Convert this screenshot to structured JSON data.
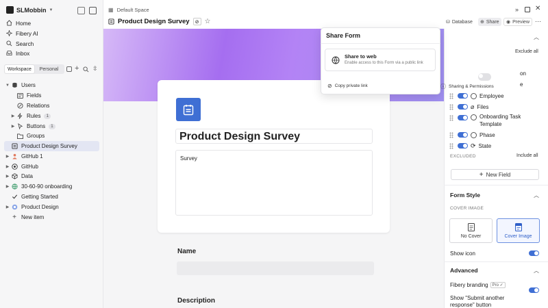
{
  "workspace": {
    "name": "SLMobbin"
  },
  "sidebar": {
    "nav": [
      {
        "label": "Home",
        "icon": "home-icon"
      },
      {
        "label": "Fibery AI",
        "icon": "sparkle-icon"
      },
      {
        "label": "Search",
        "icon": "search-icon"
      },
      {
        "label": "Inbox",
        "icon": "inbox-icon"
      }
    ],
    "tabs": [
      "Workspace",
      "Personal"
    ],
    "tree": [
      {
        "label": "Users",
        "icon": "database-icon",
        "expanded": true
      },
      {
        "label": "Fields",
        "icon": "fields-icon"
      },
      {
        "label": "Relations",
        "icon": "relations-icon"
      },
      {
        "label": "Rules",
        "icon": "lightning-icon",
        "count": "1"
      },
      {
        "label": "Buttons",
        "icon": "cursor-icon",
        "count": "1"
      },
      {
        "label": "Groups",
        "icon": "folder-icon"
      },
      {
        "label": "Product Design Survey",
        "icon": "form-icon",
        "selected": true
      },
      {
        "label": "GitHub 1",
        "icon": "person-icon"
      },
      {
        "label": "GitHub",
        "icon": "github-icon"
      },
      {
        "label": "Data",
        "icon": "cube-icon"
      },
      {
        "label": "30-60-90 onboarding",
        "icon": "globe-icon"
      },
      {
        "label": "Getting Started",
        "icon": "check-icon"
      },
      {
        "label": "Product Design",
        "icon": "target-icon"
      }
    ],
    "new_item": "New item"
  },
  "header": {
    "breadcrumb": "Default Space",
    "title": "Product Design Survey",
    "buttons": {
      "database": "Database",
      "share": "Share",
      "preview": "Preview"
    }
  },
  "form": {
    "title": "Product Design Survey",
    "description": "Survey",
    "fields": [
      {
        "label": "Name"
      },
      {
        "label": "Description"
      }
    ]
  },
  "share_popover": {
    "title": "Share Form",
    "share_web_title": "Share to web",
    "share_web_desc": "Enable access to this Form via a public link",
    "share_web_enabled": false,
    "copy_link": "Copy private link",
    "sharing_permissions": "Sharing & Permissions"
  },
  "right_panel": {
    "exclude_all": "Exclude all",
    "partial_row1": "on",
    "partial_row2": "e",
    "included_fields": [
      {
        "label": "Employee",
        "icon": "person-circle-icon",
        "on": true
      },
      {
        "label": "Files",
        "icon": "paperclip-icon",
        "on": true
      },
      {
        "label": "Onboarding Task Template",
        "icon": "relation-icon",
        "on": true
      },
      {
        "label": "Phase",
        "icon": "chevron-circle-icon",
        "on": true
      },
      {
        "label": "State",
        "icon": "workflow-icon",
        "on": true
      }
    ],
    "excluded_label": "EXCLUDED",
    "include_all": "Include all",
    "new_field": "New Field",
    "form_style": {
      "title": "Form Style",
      "cover_image_label": "COVER IMAGE",
      "options": [
        {
          "label": "No Cover",
          "selected": false
        },
        {
          "label": "Cover Image",
          "selected": true
        }
      ],
      "show_icon": "Show icon",
      "show_icon_on": true
    },
    "advanced": {
      "title": "Advanced",
      "fibery_branding": "Fibery branding",
      "pro_badge": "Pro",
      "fibery_branding_on": true,
      "submit_another_line1": "Show \"Submit another",
      "submit_another_line2": "response\" button",
      "submit_another_on": false
    }
  },
  "colors": {
    "accent": "#3f6fd4",
    "selection": "#e3e6f3",
    "cover_start": "#d6b9f7",
    "cover_mid": "#a56ef0"
  }
}
